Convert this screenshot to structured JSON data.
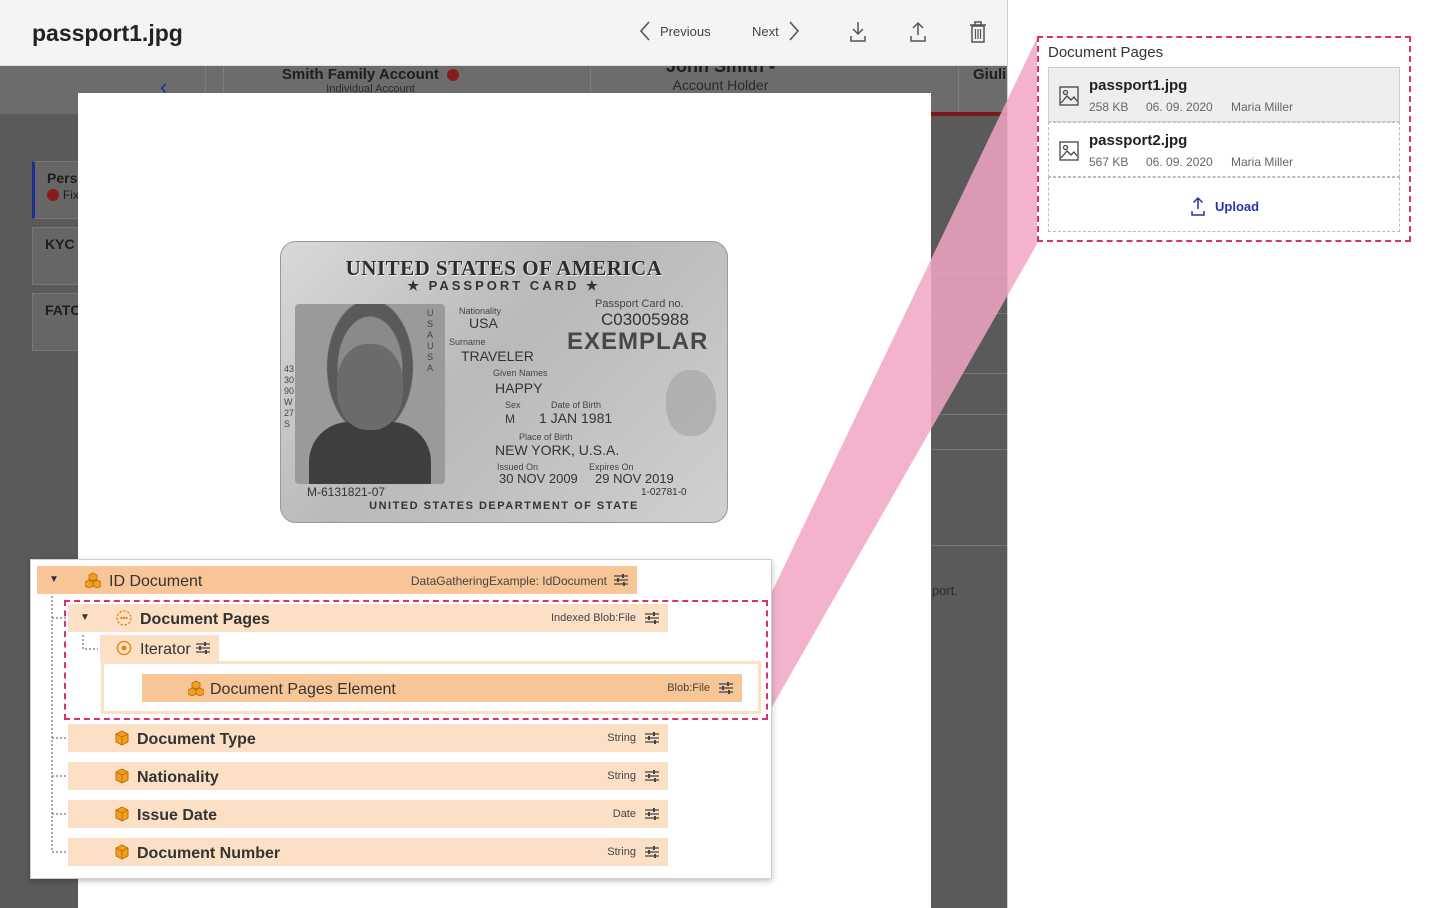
{
  "viewer": {
    "title": "passport1.jpg",
    "prev_label": "Previous",
    "next_label": "Next",
    "icons": [
      "download-icon",
      "upload-icon",
      "trash-icon"
    ]
  },
  "background": {
    "tab1_title": "Smith Family Account",
    "tab1_sub": "Individual Account",
    "tab2_title": "John Smith -",
    "tab2_sub": "Account Holder",
    "tab3_title": "Giulia",
    "card1_line1": "Perso",
    "card1_line2": "Fix",
    "card2": "KYC",
    "card3": "FATC",
    "side_text": "port."
  },
  "passport": {
    "country": "UNITED STATES OF AMERICA",
    "card_type": "★ PASSPORT CARD ★",
    "nationality_label": "Nationality",
    "nationality": "USA",
    "card_no_label": "Passport Card no.",
    "card_no": "C03005988",
    "surname_label": "Surname",
    "surname": "TRAVELER",
    "exemplar": "EXEMPLAR",
    "given_label": "Given Names",
    "given": "HAPPY",
    "sex_label": "Sex",
    "sex": "M",
    "dob_label": "Date of Birth",
    "dob": "1 JAN 1981",
    "pob_label": "Place of Birth",
    "pob": "NEW YORK, U.S.A.",
    "issued_label": "Issued On",
    "issued": "30 NOV 2009",
    "expires_label": "Expires On",
    "expires": "29 NOV 2019",
    "mrz_left": "M-6131821-07",
    "mrz_right": "1-02781-0",
    "dept": "UNITED STATES DEPARTMENT OF STATE",
    "vertical_text": "USAUSA",
    "vertical_text2": "433090W27S"
  },
  "pages_panel": {
    "heading": "Document Pages",
    "items": [
      {
        "name": "passport1.jpg",
        "size": "258 KB",
        "date": "06. 09. 2020",
        "user": "Maria Miller"
      },
      {
        "name": "passport2.jpg",
        "size": "567 KB",
        "date": "06. 09. 2020",
        "user": "Maria Miller"
      }
    ],
    "upload_label": "Upload"
  },
  "tree": {
    "root": {
      "label": "ID Document",
      "type": "DataGatheringExample: IdDocument"
    },
    "pages": {
      "label": "Document Pages",
      "type": "Indexed Blob:File"
    },
    "iterator": {
      "label": "Iterator"
    },
    "element": {
      "label": "Document Pages Element",
      "type": "Blob:File"
    },
    "fields": [
      {
        "label": "Document Type",
        "type": "String"
      },
      {
        "label": "Nationality",
        "type": "String"
      },
      {
        "label": "Issue Date",
        "type": "Date"
      },
      {
        "label": "Document Number",
        "type": "String"
      }
    ]
  },
  "colors": {
    "accent_pink": "#d6336c",
    "connector_pink": "#f2a6c4",
    "node_strong": "#f8c696",
    "node_light": "#fbe0c6",
    "link_blue": "#2533a8"
  }
}
